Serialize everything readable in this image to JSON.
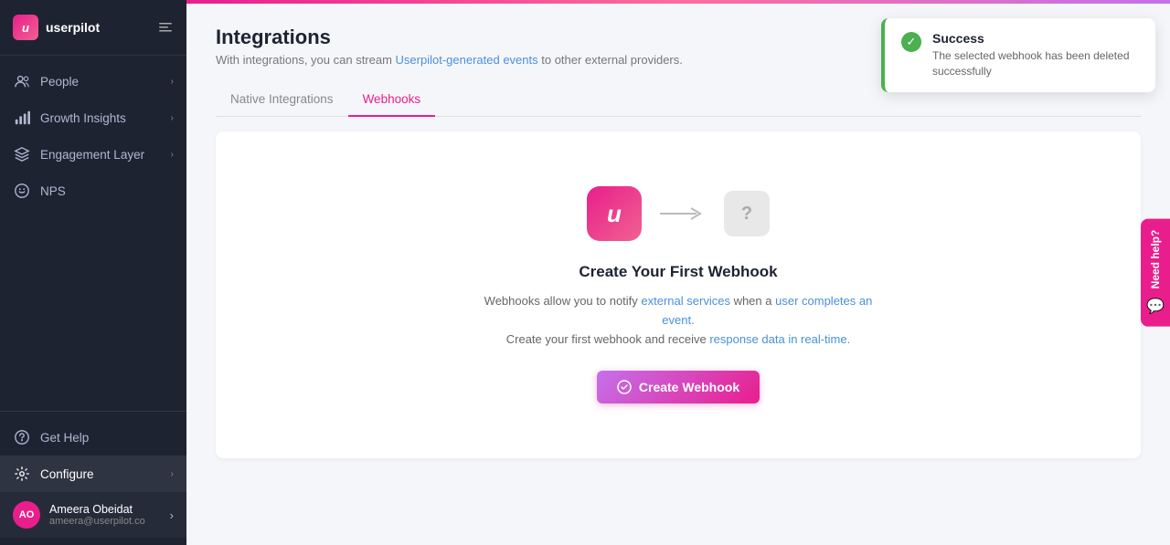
{
  "sidebar": {
    "logo": {
      "text": "userpilot",
      "icon_label": "u"
    },
    "nav_items": [
      {
        "id": "people",
        "label": "People",
        "icon": "people"
      },
      {
        "id": "growth-insights",
        "label": "Growth Insights",
        "icon": "chart"
      },
      {
        "id": "engagement-layer",
        "label": "Engagement Layer",
        "icon": "layers"
      },
      {
        "id": "nps",
        "label": "NPS",
        "icon": "nps"
      }
    ],
    "bottom_items": [
      {
        "id": "get-help",
        "label": "Get Help",
        "icon": "help"
      },
      {
        "id": "configure",
        "label": "Configure",
        "icon": "gear",
        "active": true
      }
    ],
    "user": {
      "initials": "AO",
      "name": "Ameera Obeidat",
      "email": "ameera@userpilot.co"
    }
  },
  "header": {
    "title": "Integrations",
    "subtitle_prefix": "With integrations, you can stream Userpilot-generated events to other external providers.",
    "subtitle_link": "Userpilot-generated events"
  },
  "tabs": [
    {
      "id": "native-integrations",
      "label": "Native Integrations",
      "active": false
    },
    {
      "id": "webhooks",
      "label": "Webhooks",
      "active": true
    }
  ],
  "empty_state": {
    "title": "Create Your First Webhook",
    "description_line1": "Webhooks allow you to notify external services when a user completes an event.",
    "description_line2": "Create your first webhook and receive response data in real-time.",
    "button_label": "Create Webhook"
  },
  "toast": {
    "title": "Success",
    "message": "The selected webhook has been deleted successfully"
  },
  "need_help": {
    "label": "Need help?"
  }
}
